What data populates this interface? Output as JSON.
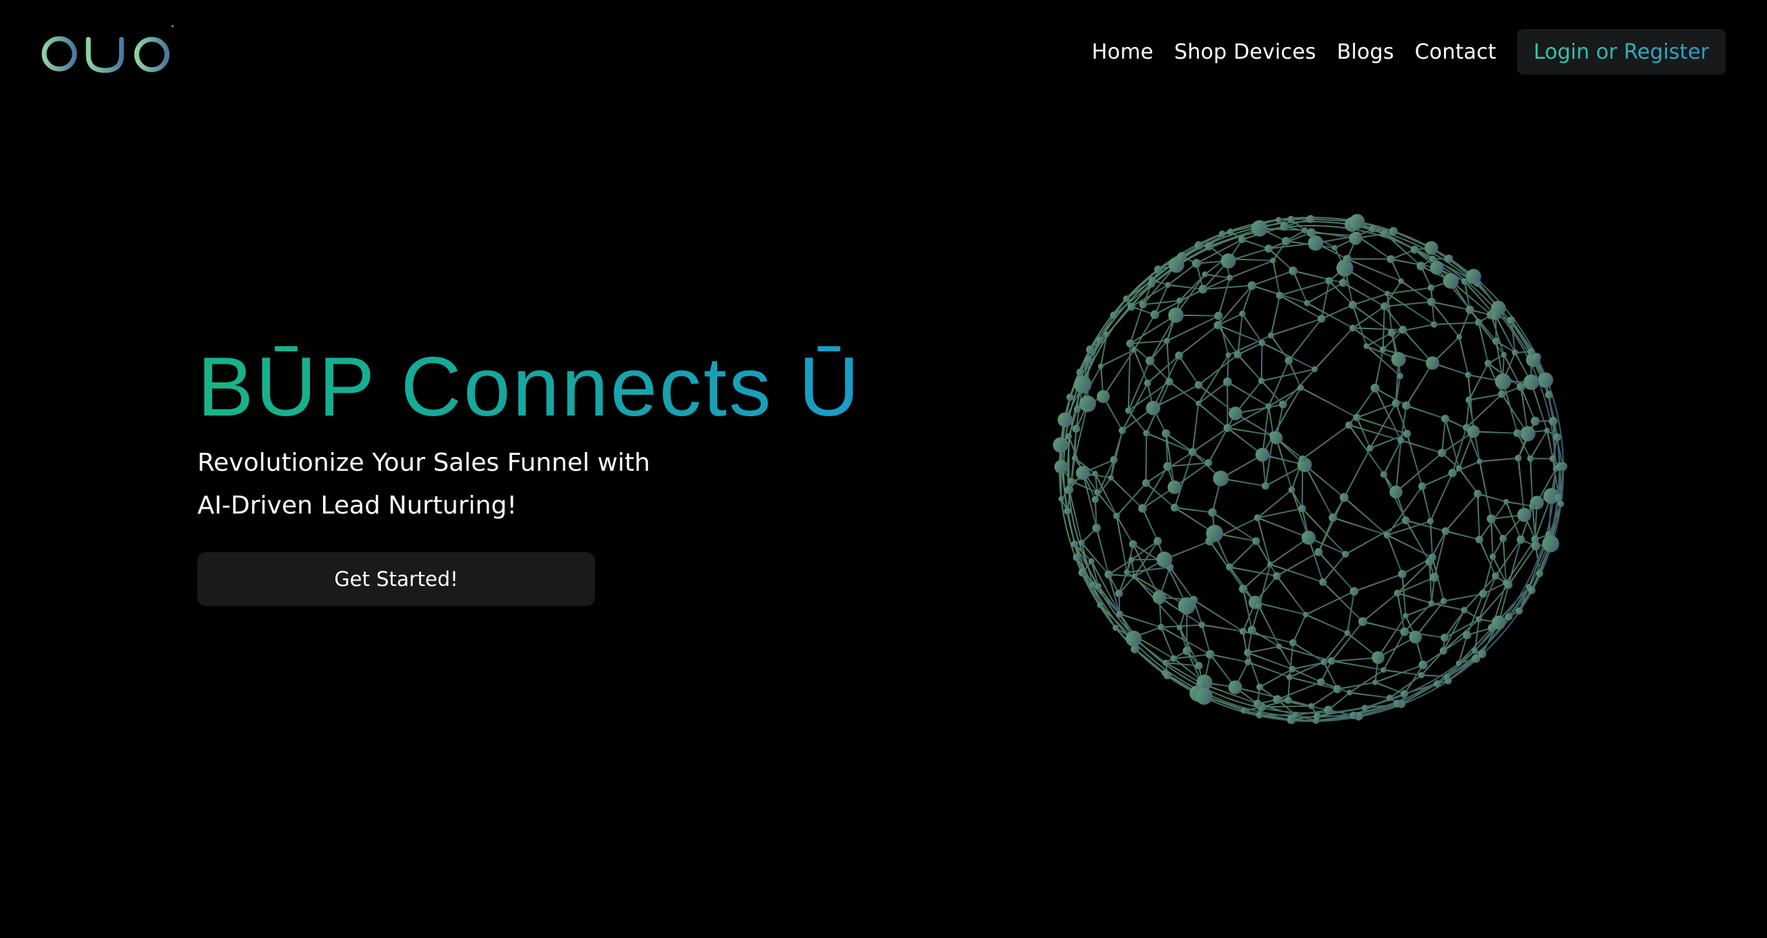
{
  "header": {
    "logo_text": "būp",
    "nav": [
      {
        "label": "Home"
      },
      {
        "label": "Shop Devices"
      },
      {
        "label": "Blogs"
      },
      {
        "label": "Contact"
      }
    ],
    "login_label": "Login or Register"
  },
  "hero": {
    "title": "BŪP Connects Ū",
    "subtitle_line1": "Revolutionize Your Sales Funnel with",
    "subtitle_line2": "AI-Driven Lead Nurturing!",
    "cta_label": "Get Started!"
  },
  "colors": {
    "background": "#000000",
    "accent_green": "#17b486",
    "accent_blue": "#1a9cc9",
    "button_dark": "#1a1a1a",
    "globe_green": "#5a8f72",
    "globe_blue": "#46637a"
  },
  "icons": {
    "globe": "network-globe-icon",
    "logo": "bup-logo-icon"
  }
}
